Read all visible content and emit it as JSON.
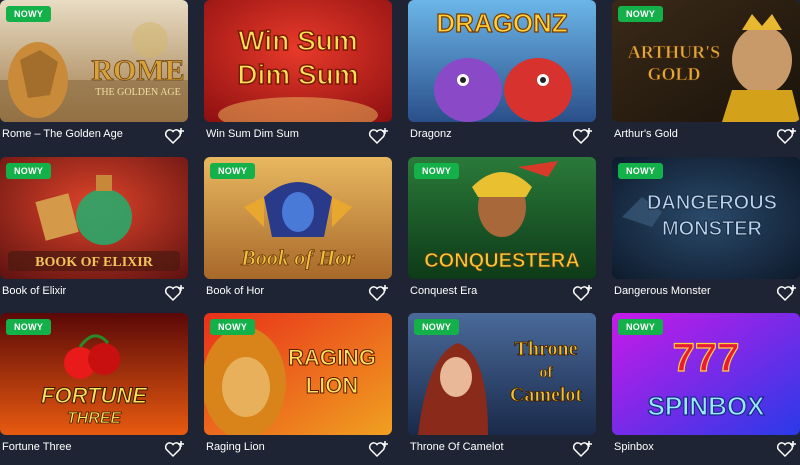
{
  "badge_label": "NOWY",
  "accent": "#14b04a",
  "background": "#1e2433",
  "games": [
    {
      "title": "Rome – The Golden Age",
      "art_line1": "ROME",
      "art_line2": "THE GOLDEN AGE",
      "is_new": true
    },
    {
      "title": "Win Sum Dim Sum",
      "art_line1": "Win Sum",
      "art_line2": "Dim Sum",
      "is_new": false
    },
    {
      "title": "Dragonz",
      "art_line1": "DRAGONZ",
      "is_new": false
    },
    {
      "title": "Arthur's Gold",
      "art_line1": "ARTHUR'S",
      "art_line2": "GOLD",
      "is_new": true
    },
    {
      "title": "Book of Elixir",
      "art_line1": "BOOK OF ELIXIR",
      "is_new": true
    },
    {
      "title": "Book of Hor",
      "art_line1": "Book of Hor",
      "is_new": true
    },
    {
      "title": "Conquest Era",
      "art_line1": "CONQUESTERA",
      "is_new": true
    },
    {
      "title": "Dangerous Monster",
      "art_line1": "DANGEROUS",
      "art_line2": "MONSTER",
      "is_new": true
    },
    {
      "title": "Fortune Three",
      "art_line1": "FORTUNE",
      "art_line2": "THREE",
      "is_new": true
    },
    {
      "title": "Raging Lion",
      "art_line1": "RAGING",
      "art_line2": "LION",
      "is_new": true
    },
    {
      "title": "Throne Of Camelot",
      "art_line1": "Throne",
      "art_line2": "of",
      "art_line3": "Camelot",
      "is_new": true
    },
    {
      "title": "Spinbox",
      "art_line1": "777",
      "art_line2": "SPINBOX",
      "is_new": true
    }
  ]
}
